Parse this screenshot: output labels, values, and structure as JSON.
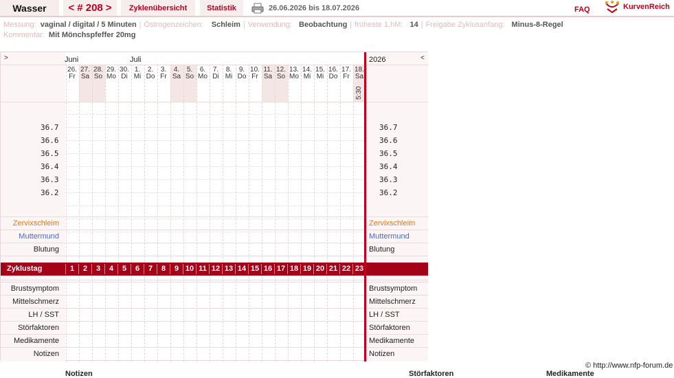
{
  "header": {
    "user": "Wasser",
    "cycle_nav": {
      "prev": "<",
      "label": "# 208",
      "next": ">"
    },
    "overview_label": "Zyklenübersicht",
    "stats_label": "Statistik",
    "print_icon": "printer-icon",
    "date_range": "26.06.2026 bis 18.07.2026",
    "faq_label": "FAQ",
    "logo_icon": "curve-logo-icon",
    "logo_text": "KurvenReich"
  },
  "info": {
    "messung_label": "Messung:",
    "messung_value": "vaginal / digital / 5 Minuten",
    "oestrogen_label": "Östrogenzeichen:",
    "oestrogen_value": "Schleim",
    "verwendung_label": "Verwendung:",
    "verwendung_value": "Beobachtung",
    "frueheste_label": "früheste 1.hM:",
    "frueheste_value": "14",
    "freigabe_label": "Freigabe Zyklusanfang:",
    "freigabe_value": "Minus-8-Regel",
    "kommentar_label": "Kommentar:",
    "kommentar_value": "Mit Mönchspfeffer  20mg"
  },
  "chart": {
    "nav_left": ">",
    "nav_right": "<",
    "months": [
      {
        "label": "Juni",
        "col": 0
      },
      {
        "label": "Juli",
        "col": 5
      }
    ],
    "year": "2026",
    "days": [
      {
        "num": "26.",
        "name": "Fr",
        "weekend": false
      },
      {
        "num": "27.",
        "name": "Sa",
        "weekend": true
      },
      {
        "num": "28.",
        "name": "So",
        "weekend": true
      },
      {
        "num": "29.",
        "name": "Mo",
        "weekend": false
      },
      {
        "num": "30.",
        "name": "Di",
        "weekend": false
      },
      {
        "num": "1.",
        "name": "Mi",
        "weekend": false
      },
      {
        "num": "2.",
        "name": "Do",
        "weekend": false
      },
      {
        "num": "3.",
        "name": "Fr",
        "weekend": false
      },
      {
        "num": "4.",
        "name": "Sa",
        "weekend": true
      },
      {
        "num": "5.",
        "name": "So",
        "weekend": true
      },
      {
        "num": "6.",
        "name": "Mo",
        "weekend": false
      },
      {
        "num": "7.",
        "name": "Di",
        "weekend": false
      },
      {
        "num": "8.",
        "name": "Mi",
        "weekend": false
      },
      {
        "num": "9.",
        "name": "Do",
        "weekend": false
      },
      {
        "num": "10.",
        "name": "Fr",
        "weekend": false
      },
      {
        "num": "11.",
        "name": "Sa",
        "weekend": true
      },
      {
        "num": "12.",
        "name": "So",
        "weekend": true
      },
      {
        "num": "13.",
        "name": "Mo",
        "weekend": false
      },
      {
        "num": "14.",
        "name": "Mi",
        "weekend": false
      },
      {
        "num": "15.",
        "name": "Mi",
        "weekend": false
      },
      {
        "num": "16.",
        "name": "Do",
        "weekend": false
      },
      {
        "num": "17.",
        "name": "Fr",
        "weekend": false
      },
      {
        "num": "18.",
        "name": "Sa",
        "weekend": true
      }
    ],
    "measure_time": "5:30",
    "temperatures": [
      "36.7",
      "36.6",
      "36.5",
      "36.4",
      "36.3",
      "36.2"
    ],
    "rows_top": [
      "Zervixschleim",
      "Muttermund",
      "Blutung"
    ],
    "cycle_day_label": "Zyklustag",
    "cycle_days": [
      "1",
      "2",
      "3",
      "4",
      "5",
      "6",
      "7",
      "8",
      "9",
      "10",
      "11",
      "12",
      "13",
      "14",
      "15",
      "16",
      "17",
      "18",
      "19",
      "20",
      "21",
      "22",
      "23"
    ],
    "rows_bottom": [
      "Brustsymptom",
      "Mittelschmerz",
      "LH / SST",
      "Störfaktoren",
      "Medikamente",
      "Notizen"
    ]
  },
  "footer": {
    "copyright": "© http://www.nfp-forum.de",
    "notizen": "Notizen",
    "stoerfaktoren": "Störfaktoren",
    "medikamente": "Medikamente"
  },
  "colors": {
    "accent": "#c0001a",
    "bar": "#a40018",
    "cervix": "#e07a1a",
    "muttermund": "#4f68c0"
  }
}
